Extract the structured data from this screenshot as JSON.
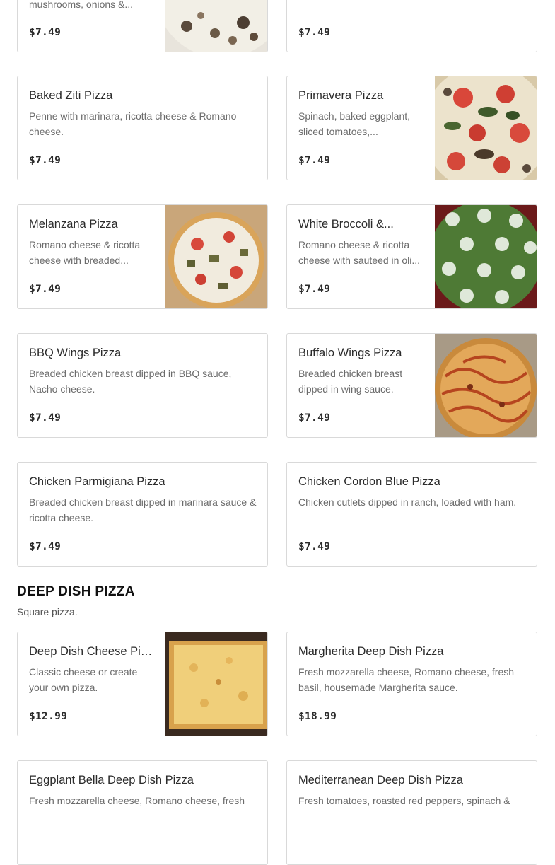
{
  "menu": {
    "cards": [
      {
        "id": "r0l",
        "name": "",
        "desc": "mushrooms, onions &...",
        "price": "$7.49"
      },
      {
        "id": "r0r",
        "name": "",
        "desc": "",
        "price": "$7.49"
      },
      {
        "id": "r1l",
        "name": "Baked Ziti Pizza",
        "desc": "Penne with marinara, ricotta cheese & Romano cheese.",
        "price": "$7.49"
      },
      {
        "id": "r1r",
        "name": "Primavera Pizza",
        "desc": "Spinach, baked eggplant, sliced tomatoes,...",
        "price": "$7.49"
      },
      {
        "id": "r2l",
        "name": "Melanzana Pizza",
        "desc": "Romano cheese & ricotta cheese with breaded...",
        "price": "$7.49"
      },
      {
        "id": "r2r",
        "name": "White Broccoli &...",
        "desc": "Romano cheese & ricotta cheese with sauteed in oli...",
        "price": "$7.49"
      },
      {
        "id": "r3l",
        "name": "BBQ Wings Pizza",
        "desc": "Breaded chicken breast dipped in BBQ sauce, Nacho cheese.",
        "price": "$7.49"
      },
      {
        "id": "r3r",
        "name": "Buffalo Wings Pizza",
        "desc": "Breaded chicken breast dipped in wing sauce.",
        "price": "$7.49"
      },
      {
        "id": "r4l",
        "name": "Chicken Parmigiana Pizza",
        "desc": "Breaded chicken breast dipped in marinara sauce & ricotta cheese.",
        "price": "$7.49"
      },
      {
        "id": "r4r",
        "name": "Chicken Cordon Blue Pizza",
        "desc": "Chicken cutlets dipped in ranch, loaded with ham.",
        "price": "$7.49"
      }
    ]
  },
  "deep_dish": {
    "title": "DEEP DISH PIZZA",
    "subtitle": "Square pizza.",
    "cards": [
      {
        "id": "d0l",
        "name": "Deep Dish Cheese Pizza",
        "desc": "Classic cheese or create your own pizza.",
        "price": "$12.99"
      },
      {
        "id": "d0r",
        "name": "Margherita Deep Dish Pizza",
        "desc": "Fresh mozzarella cheese, Romano cheese, fresh basil, housemade Margherita sauce.",
        "price": "$18.99"
      },
      {
        "id": "d1l",
        "name": "Eggplant Bella Deep Dish Pizza",
        "desc": "Fresh mozzarella cheese, Romano cheese, fresh",
        "price": ""
      },
      {
        "id": "d1r",
        "name": "Mediterranean Deep Dish Pizza",
        "desc": "Fresh tomatoes, roasted red peppers, spinach &",
        "price": ""
      }
    ]
  },
  "colors": {
    "border": "#d9d9d9",
    "text": "#2b2b2b",
    "muted": "#6b6b6b"
  },
  "icons": [
    "mushroom-pizza-photo",
    "primavera-pizza-photo",
    "melanzana-pizza-photo",
    "broccoli-pizza-photo",
    "buffalo-pizza-photo",
    "deep-dish-cheese-photo"
  ]
}
